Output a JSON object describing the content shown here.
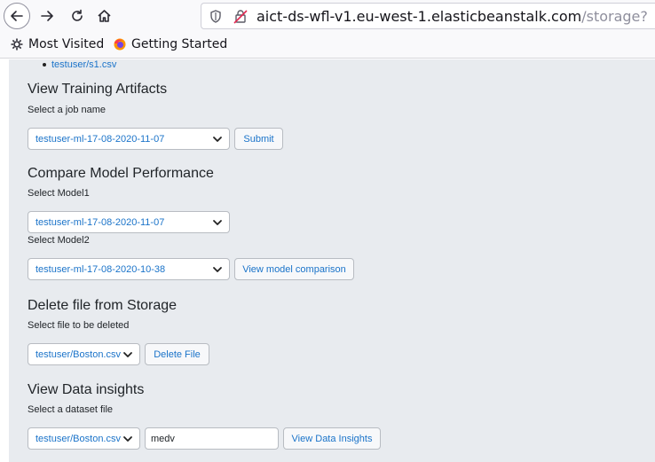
{
  "browser": {
    "url_host": "aict-ds-wfl-v1.eu-west-1.elasticbeanstalk.com",
    "url_path": "/storage?",
    "bookmarks": [
      {
        "label": "Most Visited",
        "icon": "gear-icon"
      },
      {
        "label": "Getting Started",
        "icon": "firefox-icon"
      }
    ]
  },
  "page": {
    "file_list": [
      "testuser/s1.csv"
    ],
    "training": {
      "heading": "View Training Artifacts",
      "label": "Select a job name",
      "selected": "testuser-ml-17-08-2020-11-07",
      "button": "Submit"
    },
    "compare": {
      "heading": "Compare Model Performance",
      "label1": "Select Model1",
      "selected1": "testuser-ml-17-08-2020-11-07",
      "label2": "Select Model2",
      "selected2": "testuser-ml-17-08-2020-10-38",
      "button": "View model comparison"
    },
    "delete": {
      "heading": "Delete file from Storage",
      "label": "Select file to be deleted",
      "selected": "testuser/Boston.csv",
      "button": "Delete File"
    },
    "insights": {
      "heading": "View Data insights",
      "label": "Select a dataset file",
      "selected": "testuser/Boston.csv",
      "input_value": "medv",
      "button": "View Data Insights"
    }
  },
  "colors": {
    "link": "#1a73c9",
    "panel": "#e8ebef",
    "chrome": "#f9f9fb"
  }
}
